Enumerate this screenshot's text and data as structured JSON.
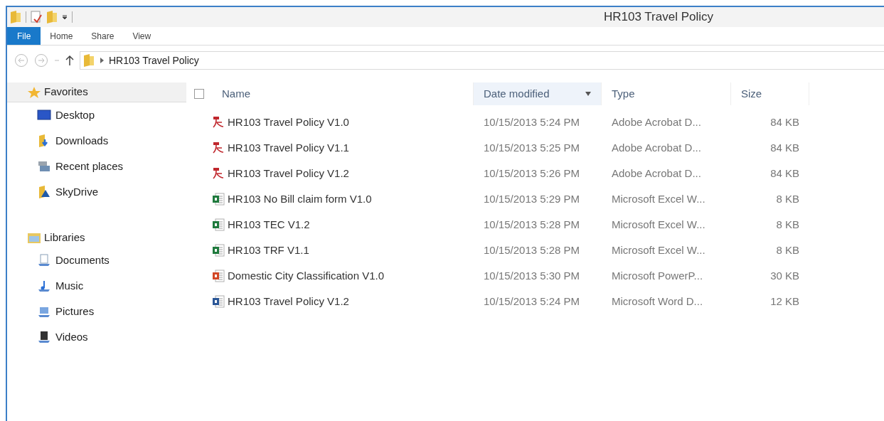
{
  "window": {
    "title": "HR103 Travel Policy"
  },
  "ribbon_tabs": [
    {
      "label": "File",
      "selected": true
    },
    {
      "label": "Home",
      "selected": false
    },
    {
      "label": "Share",
      "selected": false
    },
    {
      "label": "View",
      "selected": false
    }
  ],
  "address_bar": {
    "path": [
      "HR103 Travel Policy"
    ]
  },
  "sidebar": {
    "groups": [
      {
        "label": "Favorites",
        "kind": "star",
        "selected": true,
        "items": [
          {
            "label": "Desktop",
            "kind": "desktop"
          },
          {
            "label": "Downloads",
            "kind": "downloads"
          },
          {
            "label": "Recent places",
            "kind": "recent"
          },
          {
            "label": "SkyDrive",
            "kind": "skydrive"
          }
        ]
      },
      {
        "label": "Libraries",
        "kind": "libraries",
        "selected": false,
        "items": [
          {
            "label": "Documents",
            "kind": "documents"
          },
          {
            "label": "Music",
            "kind": "music"
          },
          {
            "label": "Pictures",
            "kind": "pictures"
          },
          {
            "label": "Videos",
            "kind": "videos"
          }
        ]
      }
    ]
  },
  "table": {
    "select_all": {
      "checked": false
    },
    "columns": [
      {
        "label": "Name",
        "selected": false
      },
      {
        "label": "Date modified",
        "selected": true
      },
      {
        "label": "Type",
        "selected": false
      },
      {
        "label": "Size",
        "selected": false
      }
    ],
    "rows": [
      {
        "kind": "pdf",
        "name": "HR103 Travel Policy V1.0",
        "date": "10/15/2013 5:24 PM",
        "type": "Adobe Acrobat D...",
        "size": "84 KB"
      },
      {
        "kind": "pdf",
        "name": "HR103 Travel Policy V1.1",
        "date": "10/15/2013 5:25 PM",
        "type": "Adobe Acrobat D...",
        "size": "84 KB"
      },
      {
        "kind": "pdf",
        "name": "HR103 Travel Policy V1.2",
        "date": "10/15/2013 5:26 PM",
        "type": "Adobe Acrobat D...",
        "size": "84 KB"
      },
      {
        "kind": "excel",
        "name": "HR103 No Bill claim form V1.0",
        "date": "10/15/2013 5:29 PM",
        "type": "Microsoft Excel W...",
        "size": "8 KB"
      },
      {
        "kind": "excel",
        "name": "HR103 TEC V1.2",
        "date": "10/15/2013 5:28 PM",
        "type": "Microsoft Excel W...",
        "size": "8 KB"
      },
      {
        "kind": "excel",
        "name": "HR103 TRF V1.1",
        "date": "10/15/2013 5:28 PM",
        "type": "Microsoft Excel W...",
        "size": "8 KB"
      },
      {
        "kind": "powerpoint",
        "name": "Domestic City Classification V1.0",
        "date": "10/15/2013 5:30 PM",
        "type": "Microsoft PowerP...",
        "size": "30 KB"
      },
      {
        "kind": "word",
        "name": "HR103 Travel Policy V1.2",
        "date": "10/15/2013 5:24 PM",
        "type": "Microsoft Word D...",
        "size": "12 KB"
      }
    ]
  }
}
